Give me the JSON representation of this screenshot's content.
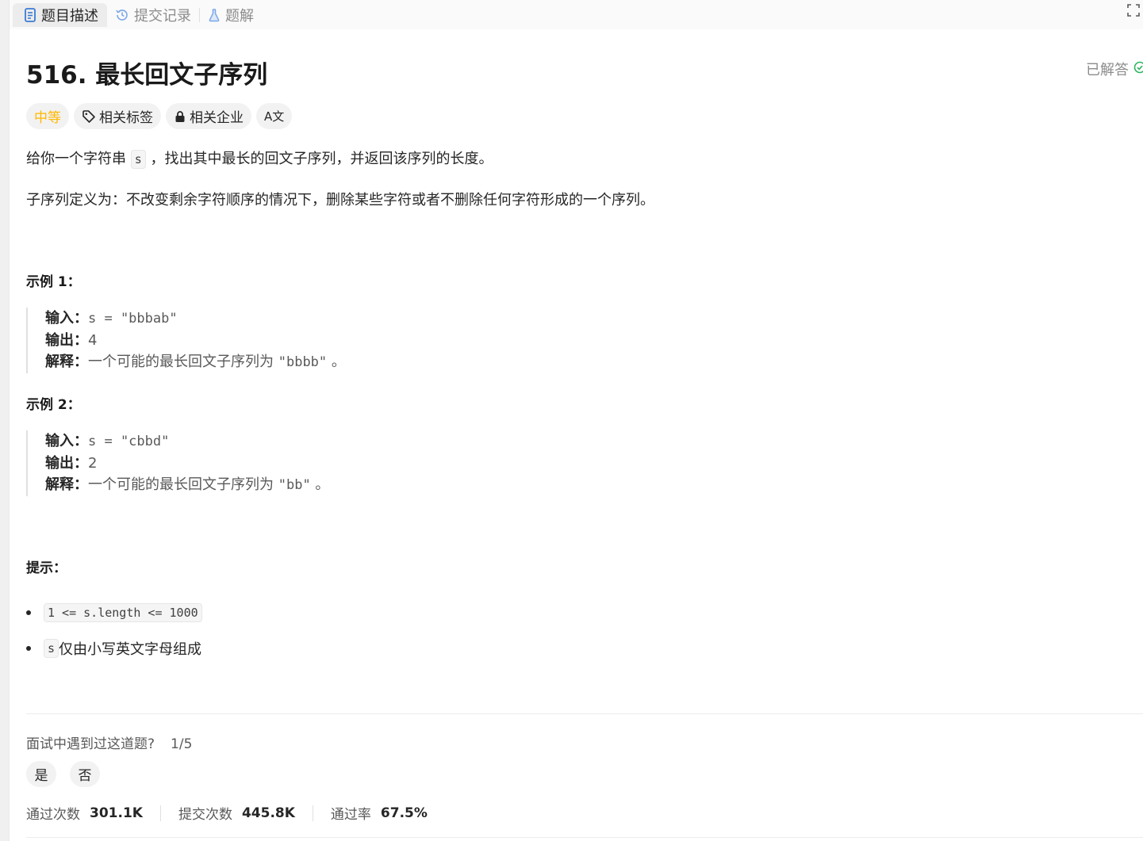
{
  "tabs": [
    {
      "label": "题目描述",
      "icon": "description-icon"
    },
    {
      "label": "提交记录",
      "icon": "history-icon"
    },
    {
      "label": "题解",
      "icon": "flask-icon"
    }
  ],
  "problem": {
    "title": "516. 最长回文子序列",
    "status": "已解答",
    "tags": {
      "difficulty": "中等",
      "related_tags": "相关标签",
      "related_companies": "相关企业",
      "translate": "A文"
    },
    "desc1_before": "给你一个字符串 ",
    "desc1_code": "s",
    "desc1_after": " ，找出其中最长的回文子序列，并返回该序列的长度。",
    "desc2": "子序列定义为：不改变剩余字符顺序的情况下，删除某些字符或者不删除任何字符形成的一个序列。"
  },
  "examples": [
    {
      "heading": "示例 1：",
      "input_label": "输入：",
      "input": "s = \"bbbab\"",
      "output_label": "输出：",
      "output": "4",
      "explain_label": "解释：",
      "explain_text": "一个可能的最长回文子序列为 ",
      "explain_code": "\"bbbb\"",
      "explain_end": " 。"
    },
    {
      "heading": "示例 2：",
      "input_label": "输入：",
      "input": "s = \"cbbd\"",
      "output_label": "输出：",
      "output": "2",
      "explain_label": "解释：",
      "explain_text": "一个可能的最长回文子序列为 ",
      "explain_code": "\"bb\"",
      "explain_end": " 。"
    }
  ],
  "hints": {
    "heading": "提示：",
    "items": [
      {
        "code": "1 <= s.length <= 1000",
        "text": ""
      },
      {
        "code": "s",
        "text": " 仅由小写英文字母组成"
      }
    ]
  },
  "interview": {
    "question": "面试中遇到过这道题?",
    "fraction": "1/5",
    "yes": "是",
    "no": "否"
  },
  "stats": [
    {
      "label": "通过次数",
      "value": "301.1K"
    },
    {
      "label": "提交次数",
      "value": "445.8K"
    },
    {
      "label": "通过率",
      "value": "67.5%"
    }
  ],
  "colors": {
    "difficulty_medium": "#ffb800",
    "accepted_green": "#2db55d",
    "tab_active_icon": "#3a7bd5"
  }
}
